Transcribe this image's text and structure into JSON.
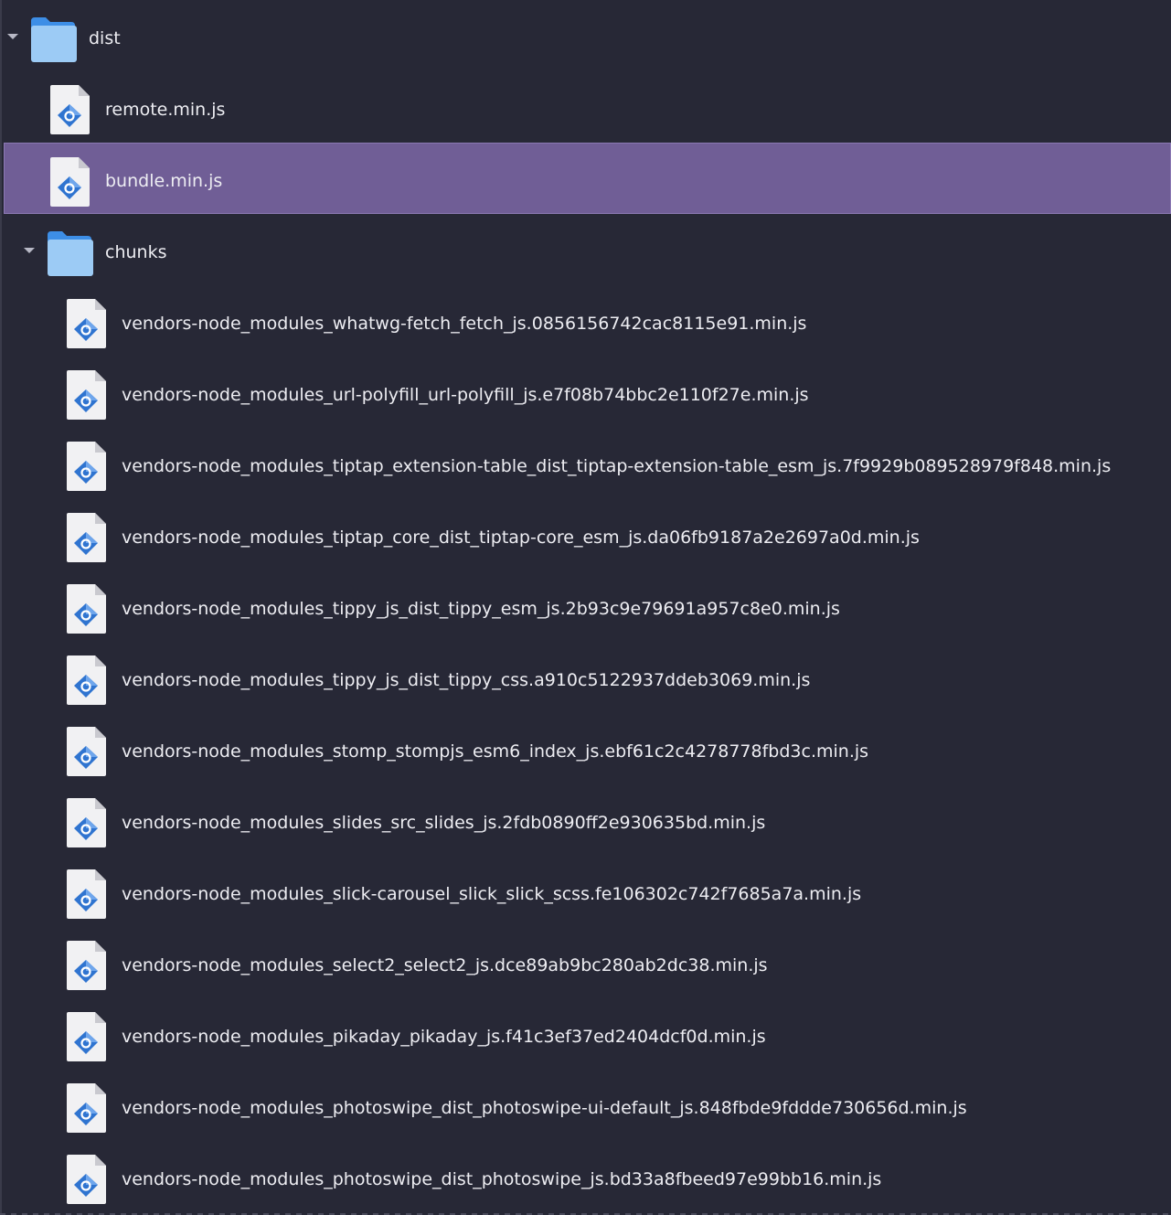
{
  "tree": {
    "root": {
      "name": "dist",
      "expanded": true,
      "icon": "folder-icon",
      "children": [
        {
          "name": "remote.min.js",
          "icon": "js-file-icon",
          "selected": false
        },
        {
          "name": "bundle.min.js",
          "icon": "js-file-icon",
          "selected": true
        }
      ],
      "subfolder": {
        "name": "chunks",
        "expanded": true,
        "icon": "folder-icon",
        "files": [
          "vendors-node_modules_whatwg-fetch_fetch_js.0856156742cac8115e91.min.js",
          "vendors-node_modules_url-polyfill_url-polyfill_js.e7f08b74bbc2e110f27e.min.js",
          "vendors-node_modules_tiptap_extension-table_dist_tiptap-extension-table_esm_js.7f9929b089528979f848.min.js",
          "vendors-node_modules_tiptap_core_dist_tiptap-core_esm_js.da06fb9187a2e2697a0d.min.js",
          "vendors-node_modules_tippy_js_dist_tippy_esm_js.2b93c9e79691a957c8e0.min.js",
          "vendors-node_modules_tippy_js_dist_tippy_css.a910c5122937ddeb3069.min.js",
          "vendors-node_modules_stomp_stompjs_esm6_index_js.ebf61c2c4278778fbd3c.min.js",
          "vendors-node_modules_slides_src_slides_js.2fdb0890ff2e930635bd.min.js",
          "vendors-node_modules_slick-carousel_slick_slick_scss.fe106302c742f7685a7a.min.js",
          "vendors-node_modules_select2_select2_js.dce89ab9bc280ab2dc38.min.js",
          "vendors-node_modules_pikaday_pikaday_js.f41c3ef37ed2404dcf0d.min.js",
          "vendors-node_modules_photoswipe_dist_photoswipe-ui-default_js.848fbde9fddde730656d.min.js",
          "vendors-node_modules_photoswipe_dist_photoswipe_js.bd33a8fbeed97e99bb16.min.js"
        ]
      }
    }
  },
  "colors": {
    "background": "#272836",
    "selection": "#705e96",
    "selection_border": "#8b79b3",
    "folder_front": "#9ccbf5",
    "folder_back": "#3d8ee6",
    "js_icon": "#2f74d0",
    "text": "#ededf2"
  }
}
